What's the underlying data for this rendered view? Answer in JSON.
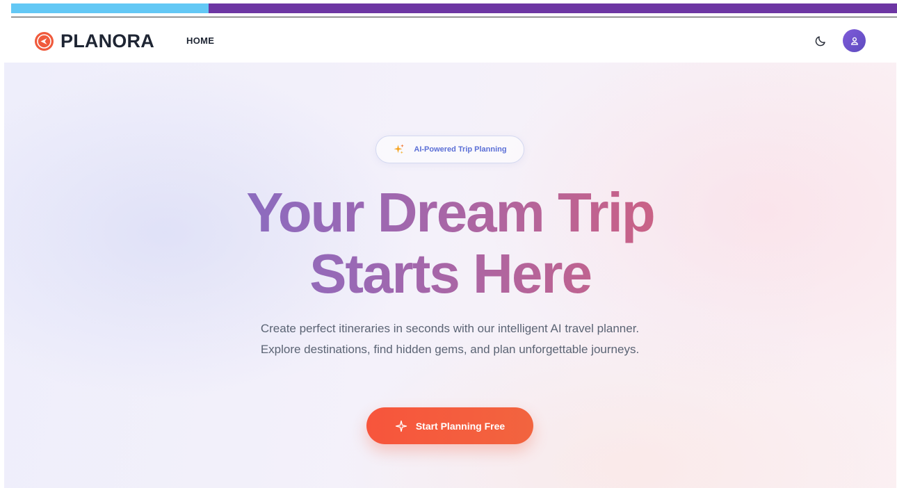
{
  "brand": {
    "name": "PLANORA",
    "logo_icon": "compass-arrow-icon",
    "accent_color": "#f05a3c"
  },
  "nav": {
    "items": [
      {
        "label": "HOME"
      }
    ],
    "theme_toggle_icon": "moon-icon",
    "avatar_icon": "user-icon"
  },
  "hero": {
    "badge": {
      "icon": "sparkles-icon",
      "text": "AI-Powered Trip Planning"
    },
    "headline": {
      "line1": "Your Dream Trip",
      "line2": "Starts Here"
    },
    "subtitle": "Create perfect itineraries in seconds with our intelligent AI travel planner. Explore destinations, find hidden gems, and plan unforgettable journeys.",
    "cta": {
      "icon": "sparkle-icon",
      "label": "Start Planning Free",
      "color": "#f7553c"
    }
  },
  "colors": {
    "headline_gradient_start": "#6f74d6",
    "headline_gradient_end": "#e65a5c",
    "avatar": "#6c52cc",
    "top_bar_left": "#63c8f5",
    "top_bar_right": "#6d36a3"
  }
}
